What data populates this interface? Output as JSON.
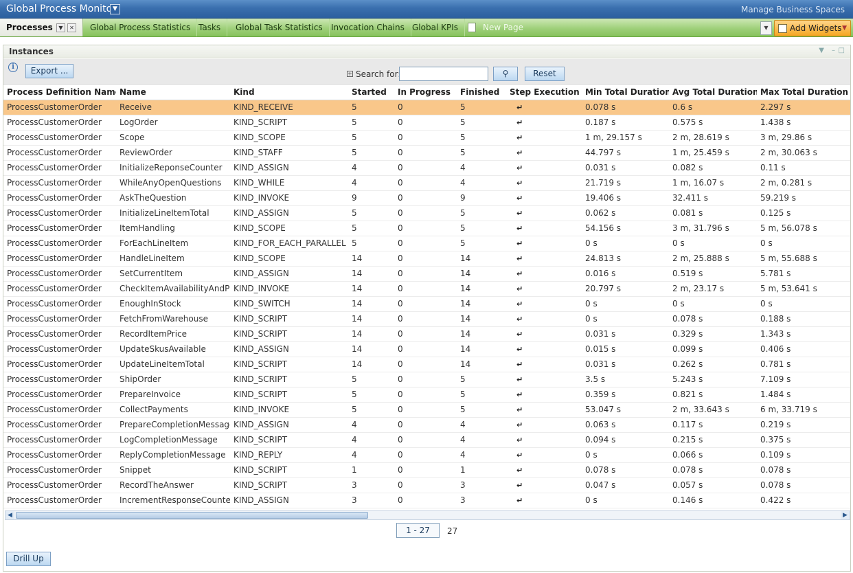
{
  "app": {
    "title": "Global Process Monitor",
    "manage_link": "Manage Business Spaces"
  },
  "tabs": [
    {
      "label": "Processes",
      "active": true
    },
    {
      "label": "Global Process Statistics"
    },
    {
      "label": "Tasks"
    },
    {
      "label": "Global Task Statistics"
    },
    {
      "label": "Invocation Chains"
    },
    {
      "label": "Global KPIs"
    },
    {
      "label": "New Page"
    }
  ],
  "add_widgets_label": "Add Widgets",
  "panel": {
    "title": "Instances",
    "export_label": "Export ...",
    "search_label": "Search for:",
    "search_value": "",
    "reset_label": "Reset",
    "drill_up_label": "Drill Up"
  },
  "table": {
    "columns": [
      "Process Definition Name",
      "Name",
      "Kind",
      "Started",
      "In Progress",
      "Finished",
      "Step Execution",
      "Min Total Duration",
      "Avg Total Duration",
      "Max Total Duration"
    ],
    "selected_row": 0,
    "rows": [
      [
        "ProcessCustomerOrder",
        "Receive",
        "KIND_RECEIVE",
        "5",
        "0",
        "5",
        "0.078 s",
        "0.6 s",
        "2.297 s"
      ],
      [
        "ProcessCustomerOrder",
        "LogOrder",
        "KIND_SCRIPT",
        "5",
        "0",
        "5",
        "0.187 s",
        "0.575 s",
        "1.438 s"
      ],
      [
        "ProcessCustomerOrder",
        "Scope",
        "KIND_SCOPE",
        "5",
        "0",
        "5",
        "1 m, 29.157 s",
        "2 m, 28.619 s",
        "3 m, 29.86 s"
      ],
      [
        "ProcessCustomerOrder",
        "ReviewOrder",
        "KIND_STAFF",
        "5",
        "0",
        "5",
        "44.797 s",
        "1 m, 25.459 s",
        "2 m, 30.063 s"
      ],
      [
        "ProcessCustomerOrder",
        "InitializeReponseCounter",
        "KIND_ASSIGN",
        "4",
        "0",
        "4",
        "0.031 s",
        "0.082 s",
        "0.11 s"
      ],
      [
        "ProcessCustomerOrder",
        "WhileAnyOpenQuestions",
        "KIND_WHILE",
        "4",
        "0",
        "4",
        "21.719 s",
        "1 m, 16.07 s",
        "2 m, 0.281 s"
      ],
      [
        "ProcessCustomerOrder",
        "AskTheQuestion",
        "KIND_INVOKE",
        "9",
        "0",
        "9",
        "19.406 s",
        "32.411 s",
        "59.219 s"
      ],
      [
        "ProcessCustomerOrder",
        "InitializeLineItemTotal",
        "KIND_ASSIGN",
        "5",
        "0",
        "5",
        "0.062 s",
        "0.081 s",
        "0.125 s"
      ],
      [
        "ProcessCustomerOrder",
        "ItemHandling",
        "KIND_SCOPE",
        "5",
        "0",
        "5",
        "54.156 s",
        "3 m, 31.796 s",
        "5 m, 56.078 s"
      ],
      [
        "ProcessCustomerOrder",
        "ForEachLineItem",
        "KIND_FOR_EACH_PARALLEL",
        "5",
        "0",
        "5",
        "0 s",
        "0 s",
        "0 s"
      ],
      [
        "ProcessCustomerOrder",
        "HandleLineItem",
        "KIND_SCOPE",
        "14",
        "0",
        "14",
        "24.813 s",
        "2 m, 25.888 s",
        "5 m, 55.688 s"
      ],
      [
        "ProcessCustomerOrder",
        "SetCurrentItem",
        "KIND_ASSIGN",
        "14",
        "0",
        "14",
        "0.016 s",
        "0.519 s",
        "5.781 s"
      ],
      [
        "ProcessCustomerOrder",
        "CheckItemAvailabilityAndPrice",
        "KIND_INVOKE",
        "14",
        "0",
        "14",
        "20.797 s",
        "2 m, 23.17 s",
        "5 m, 53.641 s"
      ],
      [
        "ProcessCustomerOrder",
        "EnoughInStock",
        "KIND_SWITCH",
        "14",
        "0",
        "14",
        "0 s",
        "0 s",
        "0 s"
      ],
      [
        "ProcessCustomerOrder",
        "FetchFromWarehouse",
        "KIND_SCRIPT",
        "14",
        "0",
        "14",
        "0 s",
        "0.078 s",
        "0.188 s"
      ],
      [
        "ProcessCustomerOrder",
        "RecordItemPrice",
        "KIND_SCRIPT",
        "14",
        "0",
        "14",
        "0.031 s",
        "0.329 s",
        "1.343 s"
      ],
      [
        "ProcessCustomerOrder",
        "UpdateSkusAvailable",
        "KIND_ASSIGN",
        "14",
        "0",
        "14",
        "0.015 s",
        "0.099 s",
        "0.406 s"
      ],
      [
        "ProcessCustomerOrder",
        "UpdateLineItemTotal",
        "KIND_SCRIPT",
        "14",
        "0",
        "14",
        "0.031 s",
        "0.262 s",
        "0.781 s"
      ],
      [
        "ProcessCustomerOrder",
        "ShipOrder",
        "KIND_SCRIPT",
        "5",
        "0",
        "5",
        "3.5 s",
        "5.243 s",
        "7.109 s"
      ],
      [
        "ProcessCustomerOrder",
        "PrepareInvoice",
        "KIND_SCRIPT",
        "5",
        "0",
        "5",
        "0.359 s",
        "0.821 s",
        "1.484 s"
      ],
      [
        "ProcessCustomerOrder",
        "CollectPayments",
        "KIND_INVOKE",
        "5",
        "0",
        "5",
        "53.047 s",
        "2 m, 33.643 s",
        "6 m, 33.719 s"
      ],
      [
        "ProcessCustomerOrder",
        "PrepareCompletionMessage",
        "KIND_ASSIGN",
        "4",
        "0",
        "4",
        "0.063 s",
        "0.117 s",
        "0.219 s"
      ],
      [
        "ProcessCustomerOrder",
        "LogCompletionMessage",
        "KIND_SCRIPT",
        "4",
        "0",
        "4",
        "0.094 s",
        "0.215 s",
        "0.375 s"
      ],
      [
        "ProcessCustomerOrder",
        "ReplyCompletionMessage",
        "KIND_REPLY",
        "4",
        "0",
        "4",
        "0 s",
        "0.066 s",
        "0.109 s"
      ],
      [
        "ProcessCustomerOrder",
        "Snippet",
        "KIND_SCRIPT",
        "1",
        "0",
        "1",
        "0.078 s",
        "0.078 s",
        "0.078 s"
      ],
      [
        "ProcessCustomerOrder",
        "RecordTheAnswer",
        "KIND_SCRIPT",
        "3",
        "0",
        "3",
        "0.047 s",
        "0.057 s",
        "0.078 s"
      ],
      [
        "ProcessCustomerOrder",
        "IncrementResponseCounter",
        "KIND_ASSIGN",
        "3",
        "0",
        "3",
        "0 s",
        "0.146 s",
        "0.422 s"
      ]
    ]
  },
  "pager": {
    "range": "1 - 27",
    "total": "27"
  },
  "icons": {
    "step_execution": "step-execution-icon"
  },
  "colors": {
    "title_bar": "#3a6fae",
    "tab_bar": "#9fd07a",
    "selected_row": "#f9c78a",
    "add_widgets": "#f5a623"
  }
}
